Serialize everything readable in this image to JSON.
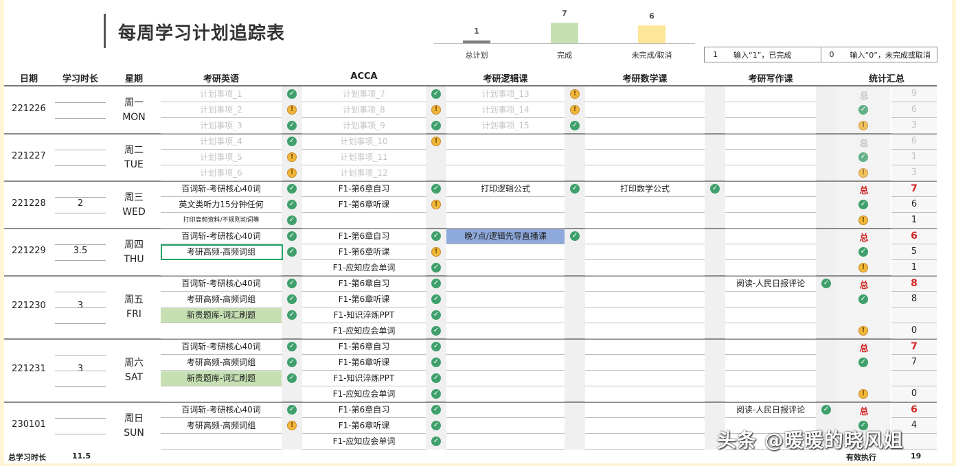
{
  "title": "每周学习计划追踪表",
  "summary": {
    "items": [
      {
        "label": "总计划",
        "value": "1",
        "color": "#7f7f7f",
        "level": 1
      },
      {
        "label": "完成",
        "value": "7",
        "color": "#c6e0b4",
        "level": 7
      },
      {
        "label": "未完成/取消",
        "value": "6",
        "color": "#ffe699",
        "level": 6
      }
    ]
  },
  "legend": [
    {
      "code": "1",
      "text": "输入“1”，已完成"
    },
    {
      "code": "0",
      "text": "输入“0”，未完成或取消"
    }
  ],
  "headers": {
    "date": "日期",
    "duration": "学习时长",
    "weekday": "星期",
    "english": "考研英语",
    "acca": "ACCA",
    "logic": "考研逻辑课",
    "math": "考研数学课",
    "writing": "考研写作课",
    "stats": "统计汇总"
  },
  "days": [
    {
      "date": "221226",
      "duration": "",
      "wd_cn": "周一",
      "wd_en": "MON"
    },
    {
      "date": "221227",
      "duration": "",
      "wd_cn": "周二",
      "wd_en": "TUE"
    },
    {
      "date": "221228",
      "duration": "2",
      "wd_cn": "周三",
      "wd_en": "WED"
    },
    {
      "date": "221229",
      "duration": "3.5",
      "wd_cn": "周四",
      "wd_en": "THU"
    },
    {
      "date": "221230",
      "duration": "3",
      "wd_cn": "周五",
      "wd_en": "FRI"
    },
    {
      "date": "221231",
      "duration": "3",
      "wd_cn": "周六",
      "wd_en": "SAT"
    },
    {
      "date": "230101",
      "duration": "",
      "wd_cn": "周日",
      "wd_en": "SUN"
    }
  ],
  "rows": [
    {
      "en": "计划事项_1",
      "en_i": "ok",
      "acca": "计划事项_7",
      "acca_i": "ok",
      "logic": "计划事项_13",
      "logic_i": "warn",
      "st_lbl": "总",
      "st_num": "9",
      "muted": true
    },
    {
      "en": "计划事项_2",
      "en_i": "warn",
      "acca": "计划事项_8",
      "acca_i": "warn",
      "logic": "计划事项_14",
      "logic_i": "warn",
      "st_i": "ok",
      "st_num": "6",
      "muted": true
    },
    {
      "en": "计划事项_3",
      "en_i": "ok",
      "acca": "计划事项_9",
      "acca_i": "ok",
      "logic": "计划事项_15",
      "logic_i": "ok",
      "st_i": "warn",
      "st_num": "3",
      "muted": true
    },
    {
      "en": "计划事项_4",
      "en_i": "ok",
      "acca": "计划事项_10",
      "acca_i": "warn",
      "st_lbl": "总",
      "st_num": "6",
      "muted": true
    },
    {
      "en": "计划事项_5",
      "en_i": "warn",
      "acca": "计划事项_11",
      "st_i": "ok",
      "st_num": "1",
      "muted": true
    },
    {
      "en": "计划事项_6",
      "en_i": "warn",
      "acca": "计划事项_12",
      "st_i": "warn",
      "st_num": "3",
      "muted": true
    },
    {
      "en": "百词斩-考研核心40词",
      "en_i": "ok",
      "acca": "F1-第6章自习",
      "acca_i": "ok",
      "logic": "打印逻辑公式",
      "logic_i": "ok",
      "math": "打印数学公式",
      "math_i": "ok",
      "st_lbl": "总",
      "st_num": "7",
      "red": true
    },
    {
      "en": "英文类听力15分钟任何",
      "en_i": "ok",
      "acca": "F1-第6章听课",
      "acca_i": "warn",
      "st_i": "ok",
      "st_num": "6"
    },
    {
      "en": "打印高频资料/不规则动词等",
      "en_i": "ok",
      "small": true,
      "st_i": "warn",
      "st_num": "1"
    },
    {
      "en": "百词斩-考研核心40词",
      "en_i": "ok",
      "acca": "F1-第6章自习",
      "acca_i": "ok",
      "logic": "晚7点/逻辑先导直播课",
      "logic_i": "ok",
      "logic_hl": true,
      "st_lbl": "总",
      "st_num": "6",
      "red": true
    },
    {
      "en": "考研高频-高频词组",
      "en_i": "ok",
      "en_sel": true,
      "acca": "F1-第6章听课",
      "acca_i": "warn",
      "st_i": "ok",
      "st_num": "5"
    },
    {
      "acca": "F1-应知应会单词",
      "acca_i": "ok",
      "st_i": "warn",
      "st_num": "1"
    },
    {
      "en": "百词斩-考研核心40词",
      "en_i": "ok",
      "acca": "F1-第6章自习",
      "acca_i": "ok",
      "writing": "阅读-人民日报评论",
      "writing_i": "ok",
      "st_lbl": "总",
      "st_num": "8",
      "red": true
    },
    {
      "en": "考研高频-高频词组",
      "en_i": "ok",
      "acca": "F1-第6章听课",
      "acca_i": "ok",
      "st_i": "ok",
      "st_num": "8"
    },
    {
      "en": "新贵题库-词汇刷题",
      "en_i": "ok",
      "en_hl": true,
      "acca": "F1-知识淬炼PPT",
      "acca_i": "ok"
    },
    {
      "acca": "F1-应知应会单词",
      "acca_i": "ok",
      "st_i": "warn",
      "st_num": "0"
    },
    {
      "en": "百词斩-考研核心40词",
      "en_i": "ok",
      "acca": "F1-第6章自习",
      "acca_i": "ok",
      "st_lbl": "总",
      "st_num": "7",
      "red": true
    },
    {
      "en": "考研高频-高频词组",
      "en_i": "ok",
      "acca": "F1-第6章听课",
      "acca_i": "ok",
      "st_i": "ok",
      "st_num": "7"
    },
    {
      "en": "新贵题库-词汇刷题",
      "en_i": "ok",
      "en_hl": true,
      "acca": "F1-知识淬炼PPT",
      "acca_i": "ok"
    },
    {
      "acca": "F1-应知应会单词",
      "acca_i": "ok",
      "st_i": "warn",
      "st_num": "0"
    },
    {
      "en": "百词斩-考研核心40词",
      "en_i": "ok",
      "acca": "F1-第6章自习",
      "acca_i": "ok",
      "writing": "阅读-人民日报评论",
      "writing_i": "ok",
      "st_lbl": "总",
      "st_num": "6",
      "red": true
    },
    {
      "en": "考研高频-高频词组",
      "en_i": "warn",
      "acca": "F1-第6章听课",
      "acca_i": "ok",
      "st_i": "ok",
      "st_num": "4"
    },
    {
      "acca": "F1-应知应会单词",
      "acca_i": "ok"
    }
  ],
  "footer": {
    "total_label": "总学习时长",
    "total_value": "11.5",
    "effective_label": "有效执行",
    "effective_value": "19"
  },
  "watermark": "头条 @暖暖的晓风姐"
}
